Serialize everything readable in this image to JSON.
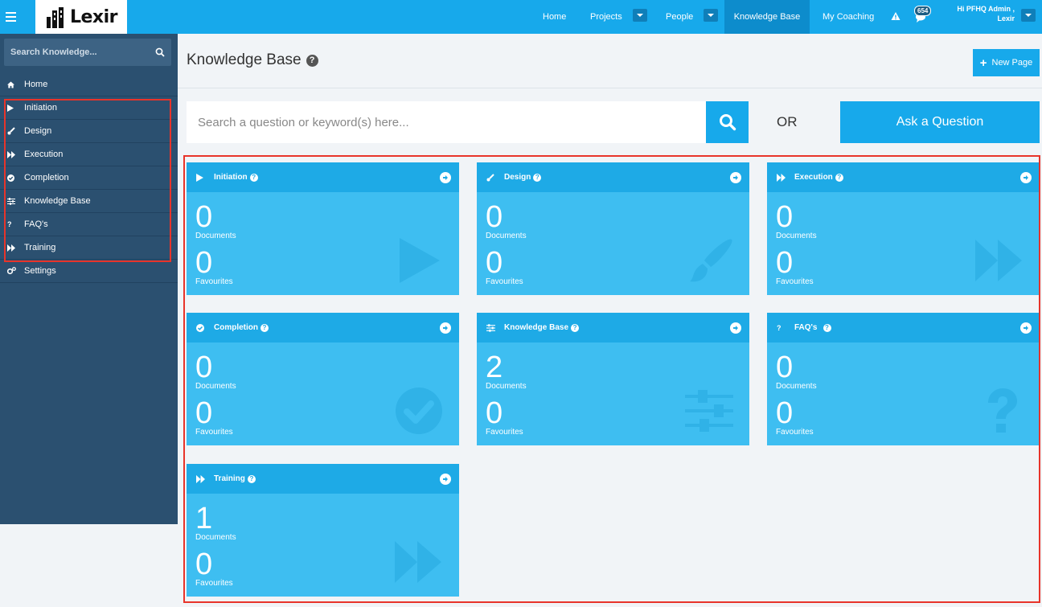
{
  "topbar": {
    "logo_text": "Lexir",
    "nav": [
      {
        "label": "Home"
      },
      {
        "label": "Projects"
      },
      {
        "label": "People"
      },
      {
        "label": "Knowledge Base"
      },
      {
        "label": "My Coaching"
      }
    ],
    "notification_count": "654",
    "user_greeting_line1": "Hi PFHQ Admin ,",
    "user_greeting_line2": "Lexir",
    "colors": {
      "bar": "#17a9eb",
      "active": "#0d8ccc"
    }
  },
  "sidebar": {
    "search_placeholder": "Search Knowledge...",
    "items": [
      {
        "label": "Home",
        "icon": "home-icon"
      },
      {
        "label": "Initiation",
        "icon": "play-icon"
      },
      {
        "label": "Design",
        "icon": "brush-icon"
      },
      {
        "label": "Execution",
        "icon": "fast-forward-icon"
      },
      {
        "label": "Completion",
        "icon": "check-circle-icon"
      },
      {
        "label": "Knowledge Base",
        "icon": "sliders-icon"
      },
      {
        "label": "FAQ's",
        "icon": "question-icon"
      },
      {
        "label": "Training",
        "icon": "fast-forward-icon"
      },
      {
        "label": "Settings",
        "icon": "gears-icon"
      }
    ]
  },
  "main": {
    "title": "Knowledge Base",
    "new_page_label": "New Page",
    "question_placeholder": "Search a question or keyword(s) here...",
    "or_label": "OR",
    "ask_label": "Ask a Question",
    "documents_label": "Documents",
    "favourites_label": "Favourites",
    "cards": [
      {
        "title": "Initiation",
        "icon": "play-icon",
        "documents": "0",
        "favourites": "0"
      },
      {
        "title": "Design",
        "icon": "brush-icon",
        "documents": "0",
        "favourites": "0"
      },
      {
        "title": "Execution",
        "icon": "fast-forward-icon",
        "documents": "0",
        "favourites": "0"
      },
      {
        "title": "Completion",
        "icon": "check-circle-icon",
        "documents": "0",
        "favourites": "0"
      },
      {
        "title": "Knowledge Base",
        "icon": "sliders-icon",
        "documents": "2",
        "favourites": "0"
      },
      {
        "title": "FAQ's",
        "icon": "question-icon",
        "documents": "0",
        "favourites": "0"
      },
      {
        "title": "Training",
        "icon": "fast-forward-icon",
        "documents": "1",
        "favourites": "0"
      }
    ]
  }
}
